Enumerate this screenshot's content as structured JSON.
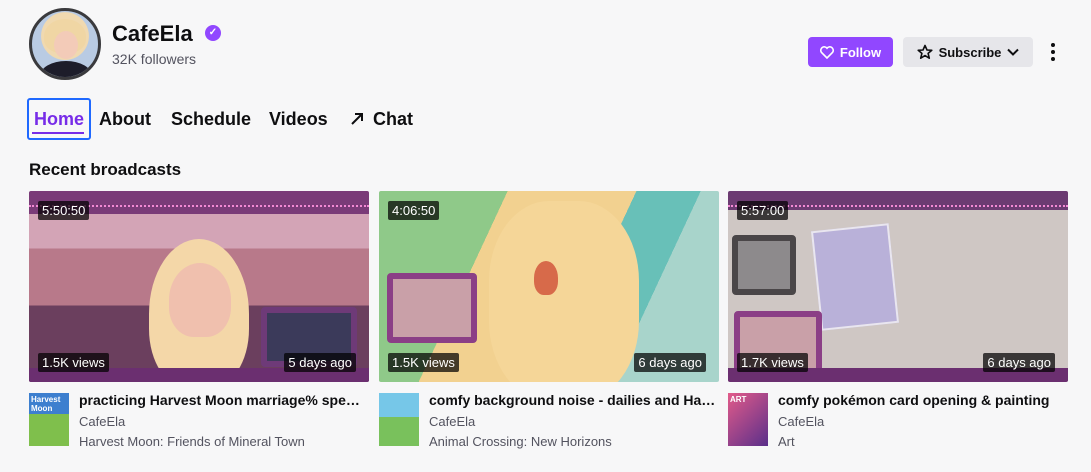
{
  "channel": {
    "name": "CafeEla",
    "followers": "32K followers",
    "verified_icon": "verified-badge-icon"
  },
  "actions": {
    "follow_label": "Follow",
    "subscribe_label": "Subscribe"
  },
  "tabs": [
    {
      "label": "Home",
      "active": true
    },
    {
      "label": "About"
    },
    {
      "label": "Schedule"
    },
    {
      "label": "Videos"
    },
    {
      "label": "Chat",
      "icon": "external-arrow-icon"
    }
  ],
  "section_title": "Recent broadcasts",
  "videos": [
    {
      "duration": "5:50:50",
      "views": "1.5K views",
      "age": "5 days ago",
      "title": "practicing Harvest Moon marriage% speedrun",
      "channel": "CafeEla",
      "game": "Harvest Moon: Friends of Mineral Town",
      "boxart_label": "Harvest Moon"
    },
    {
      "duration": "4:06:50",
      "views": "1.5K views",
      "age": "6 days ago",
      "title": "comfy background noise - dailies and Happy Home",
      "channel": "CafeEla",
      "game": "Animal Crossing: New Horizons"
    },
    {
      "duration": "5:57:00",
      "views": "1.7K views",
      "age": "6 days ago",
      "title": "comfy pokémon card opening & painting",
      "channel": "CafeEla",
      "game": "Art",
      "boxart_label": "ART"
    }
  ],
  "colors": {
    "accent": "#9147ff",
    "active_tab": "#772ce8",
    "focus_outline": "#1f69ff"
  }
}
